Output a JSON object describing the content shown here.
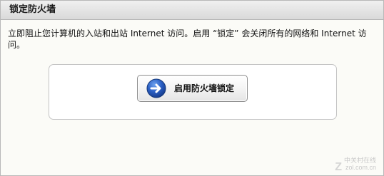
{
  "panel": {
    "title": "锁定防火墙",
    "description": "立即阻止您计算机的入站和出站 Internet 访问。启用 “锁定” 会关闭所有的网络和 Internet 访问。"
  },
  "lock_button": {
    "label": "启用防火墙锁定",
    "icon": "arrow-right-circle-icon",
    "icon_color": "#1f57b8"
  },
  "watermark": {
    "line1": "中关村在线",
    "line2": "zol.com.cn"
  }
}
